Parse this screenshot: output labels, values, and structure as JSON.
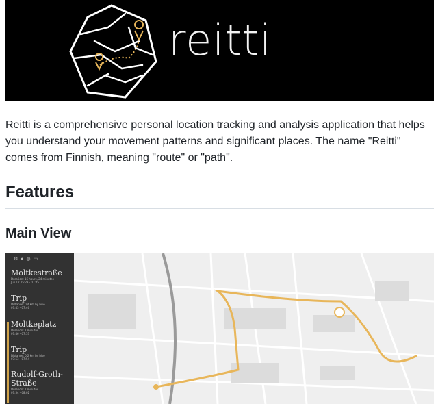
{
  "brand": {
    "name": "reitti",
    "logo_alt": "reitti logo"
  },
  "intro": "Reitti is a comprehensive personal location tracking and analysis application that helps you understand your movement patterns and significant places. The name \"Reitti\" comes from Finnish, meaning \"route\" or \"path\".",
  "sections": {
    "features_heading": "Features",
    "main_view_heading": "Main View"
  },
  "screenshot": {
    "timeline": [
      {
        "kind": "place",
        "title": "Moltkestraße",
        "line1": "Duration: 16 hours, 24 minutes",
        "line2": "Jun 17 15:23 - 07:45"
      },
      {
        "kind": "trip",
        "title": "Trip",
        "line1": "Distance: 0.4 km by bike",
        "line2": "07:43 - 07:46"
      },
      {
        "kind": "place",
        "title": "Moltkeplatz",
        "line1": "Duration: 7 minutes",
        "line2": "07:46 - 07:53"
      },
      {
        "kind": "trip",
        "title": "Trip",
        "line1": "Distance: 0.2 km by bike",
        "line2": "07:53 - 07:54"
      },
      {
        "kind": "place",
        "title": "Rudolf-Groth-Straße",
        "line1": "Duration: 7 minutes",
        "line2": "07:54 - 08:02"
      }
    ],
    "icons": [
      "settings-icon",
      "user-icon",
      "globe-icon",
      "calendar-icon"
    ],
    "route_color": "#e8b65a"
  }
}
